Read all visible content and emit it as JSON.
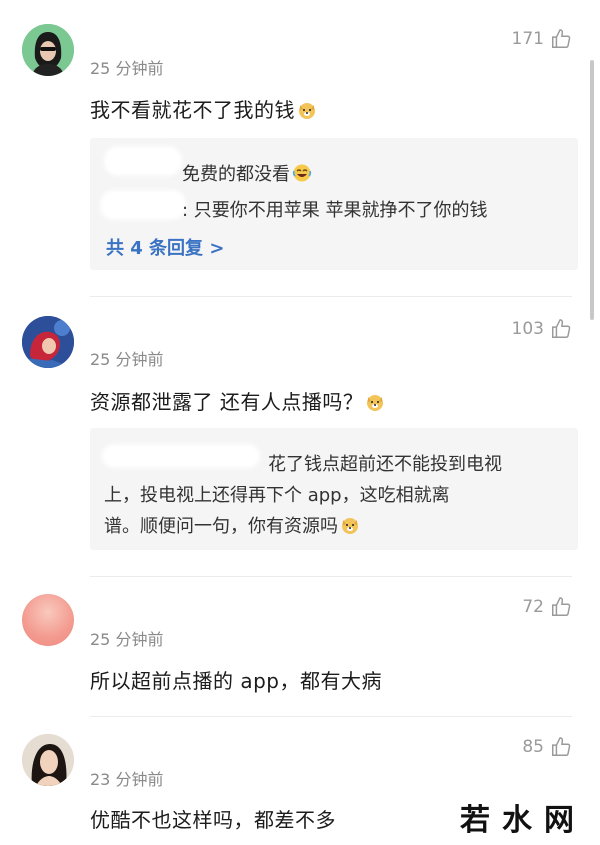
{
  "comments": [
    {
      "time": "25 分钟前",
      "likes": "171",
      "text": "我不看就花不了我的钱",
      "text_emoji": "doge",
      "replies": {
        "lines": [
          "免费的都没看",
          ": 只要你不用苹果 苹果就挣不了你的钱"
        ],
        "line1_emoji": "laughing",
        "more": "共 4 条回复 >"
      }
    },
    {
      "time": "25 分钟前",
      "likes": "103",
      "text": "资源都泄露了 还有人点播吗？",
      "text_emoji": "doge",
      "replies": {
        "lines": [
          "花了钱点超前还不能投到电视",
          "上，投电视上还得再下个 app，这吃相就离",
          "谱。顺便问一句，你有资源吗"
        ],
        "line3_emoji": "doge"
      }
    },
    {
      "time": "25 分钟前",
      "likes": "72",
      "text": "所以超前点播的 app，都有大病"
    },
    {
      "time": "23 分钟前",
      "likes": "85",
      "text": "优酷不也这样吗，都差不多"
    }
  ],
  "watermark": "若水网",
  "icons": {
    "like": "thumbs-up-icon",
    "emoji_doge": "doge-emoji-icon",
    "emoji_laugh": "laughing-emoji-icon"
  },
  "colors": {
    "link": "#3b73c4",
    "muted": "#8a8a8a",
    "reply_bg": "#f5f5f5"
  }
}
